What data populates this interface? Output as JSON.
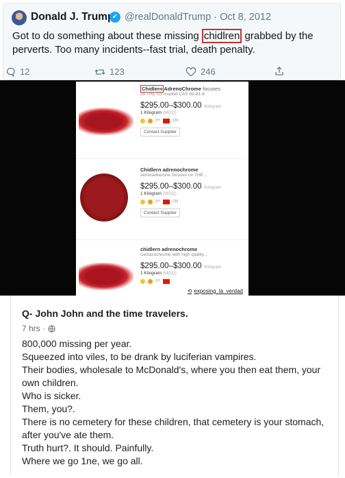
{
  "tweet": {
    "name": "Donald J. Trump",
    "handle_date": "@realDonaldTrump · Oct 8, 2012",
    "text_before": "Got to do something about these missing ",
    "text_boxed": "chidlren",
    "text_after": " grabbed by the perverts. Too many incidents--fast trial, death penalty.",
    "replies": "12",
    "retweets": "123",
    "likes": "246"
  },
  "listings": [
    {
      "title_boxed": "Chidlern",
      "title_rest": "AdrenoChrome",
      "title_tail": "focuses",
      "subtitle": "on THE US market CAS 69-81-8",
      "price": "$295.00–$300.00",
      "unit": "/Kilogram",
      "moq": "1 Kilogram",
      "moq_tag": "(MOQ)",
      "badge_years": "2ⁿᵈ",
      "country": "CN",
      "button": "Contact Supplier"
    },
    {
      "title_boxed": "",
      "title_rest": "Chidlern adrenochrome",
      "title_tail": "",
      "subtitle": "semicarbazone focuses on THE...",
      "price": "$295.00–$300.00",
      "unit": "/Kilogram",
      "moq": "1 Kilogram",
      "moq_tag": "(MOQ)",
      "badge_years": "2ⁿᵈ",
      "country": "CN",
      "button": "Contact Supplier"
    },
    {
      "title_boxed": "",
      "title_rest": "chidlern adrenochrome",
      "title_tail": "",
      "subtitle": "carbazochrome with high quality...",
      "price": "$295.00–$300.00",
      "unit": "/Kilogram",
      "moq": "1 Kilogram",
      "moq_tag": "(MOQ)",
      "badge_years": "2ⁿᵈ",
      "country": "",
      "button": ""
    }
  ],
  "watermark": "exposing_la_verdad",
  "post": {
    "title": "Q- John John and the time travelers.",
    "meta": "7 hrs ·",
    "lines": [
      "800,000 missing per year.",
      "Squeezed into viles, to be drank by luciferian vampires.",
      "Their bodies, wholesale to McDonald's, where you then eat them, your own children.",
      "Who is sicker.",
      "Them, you?.",
      "There is no cemetery for these children, that cemetery is your stomach, after you've ate them.",
      "Truth hurt?. It should. Painfully.",
      "Where we go 1ne, we go all."
    ]
  },
  "colors": {
    "twitter_blue": "#1da1f2",
    "highlight_box": "#c0342f",
    "powder_red": "#b01b22"
  }
}
